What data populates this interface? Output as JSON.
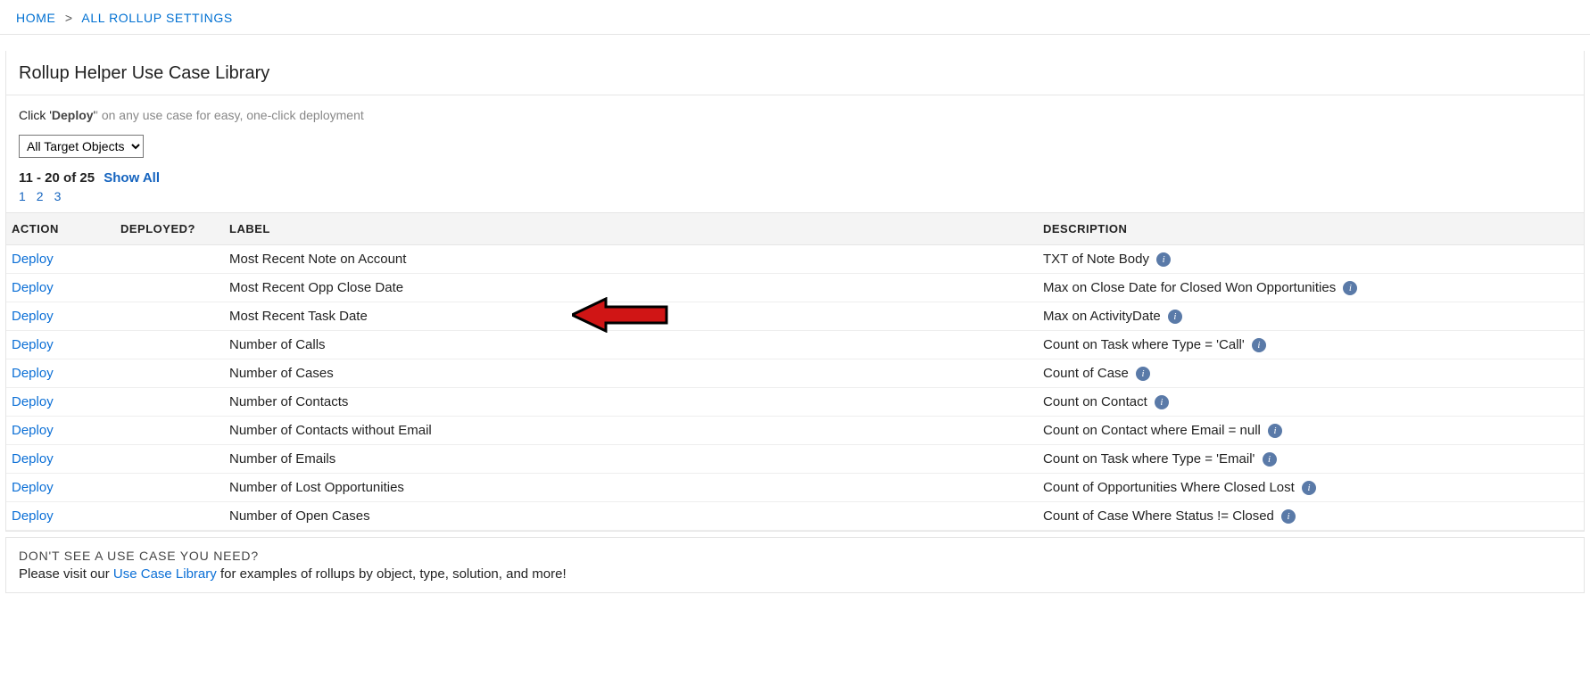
{
  "breadcrumb": {
    "home": "HOME",
    "sep": ">",
    "all_rollup": "ALL ROLLUP SETTINGS"
  },
  "panel_title": "Rollup Helper Use Case Library",
  "deploy_hint": {
    "prefix": "Click '",
    "bold": "Deploy",
    "suffix": "' on any use case for easy, one-click deployment"
  },
  "target_select": "All Target Objects",
  "paging": {
    "range": "11 - 20 of 25",
    "show_all": "Show All",
    "pages": [
      "1",
      "2",
      "3"
    ]
  },
  "columns": {
    "action": "ACTION",
    "deployed": "DEPLOYED?",
    "label": "LABEL",
    "description": "DESCRIPTION"
  },
  "deploy_label": "Deploy",
  "rows": [
    {
      "label": "Most Recent Note on Account",
      "desc": "TXT of Note Body",
      "highlight": false
    },
    {
      "label": "Most Recent Opp Close Date",
      "desc": "Max on Close Date for Closed Won Opportunities",
      "highlight": false
    },
    {
      "label": "Most Recent Task Date",
      "desc": "Max on ActivityDate",
      "highlight": true
    },
    {
      "label": "Number of Calls",
      "desc": "Count on Task where Type = 'Call'",
      "highlight": false
    },
    {
      "label": "Number of Cases",
      "desc": "Count of Case",
      "highlight": false
    },
    {
      "label": "Number of Contacts",
      "desc": "Count on Contact",
      "highlight": false
    },
    {
      "label": "Number of Contacts without Email",
      "desc": "Count on Contact where Email = null",
      "highlight": false
    },
    {
      "label": "Number of Emails",
      "desc": "Count on Task where Type = 'Email'",
      "highlight": false
    },
    {
      "label": "Number of Lost Opportunities",
      "desc": "Count of Opportunities Where Closed Lost",
      "highlight": false
    },
    {
      "label": "Number of Open Cases",
      "desc": "Count of Case Where Status != Closed",
      "highlight": false
    }
  ],
  "footer": {
    "heading": "DON'T SEE A USE CASE YOU NEED?",
    "line_prefix": "Please visit our ",
    "link": "Use Case Library",
    "line_suffix": " for examples of rollups by object, type, solution, and more!"
  }
}
